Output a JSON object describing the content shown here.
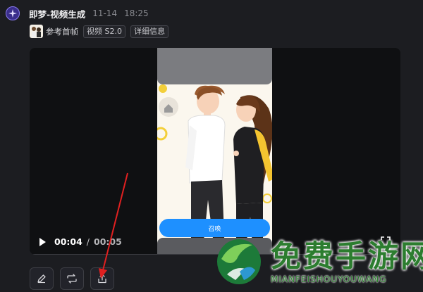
{
  "header": {
    "title": "即梦-视频生成",
    "date": "11-14",
    "time": "18:25"
  },
  "tags": {
    "reference": "参考首帧",
    "model": "视频 S2.0",
    "details": "详细信息"
  },
  "player": {
    "current_time": "00:04",
    "separator": "/",
    "total_time": "00:05",
    "cta_label": "召唤",
    "progress": 0.0
  },
  "actions": [
    {
      "icon": "edit-icon"
    },
    {
      "icon": "regenerate-icon"
    },
    {
      "icon": "share-upload-icon"
    }
  ],
  "watermark": {
    "name": "免费手游网",
    "sub": "MIANFEISHOUYOUWANG"
  },
  "colors": {
    "background": "#1c1d21",
    "cta_blue": "#1e90ff",
    "annotation_red": "#e02020",
    "watermark_green": "#2c7d2f"
  }
}
